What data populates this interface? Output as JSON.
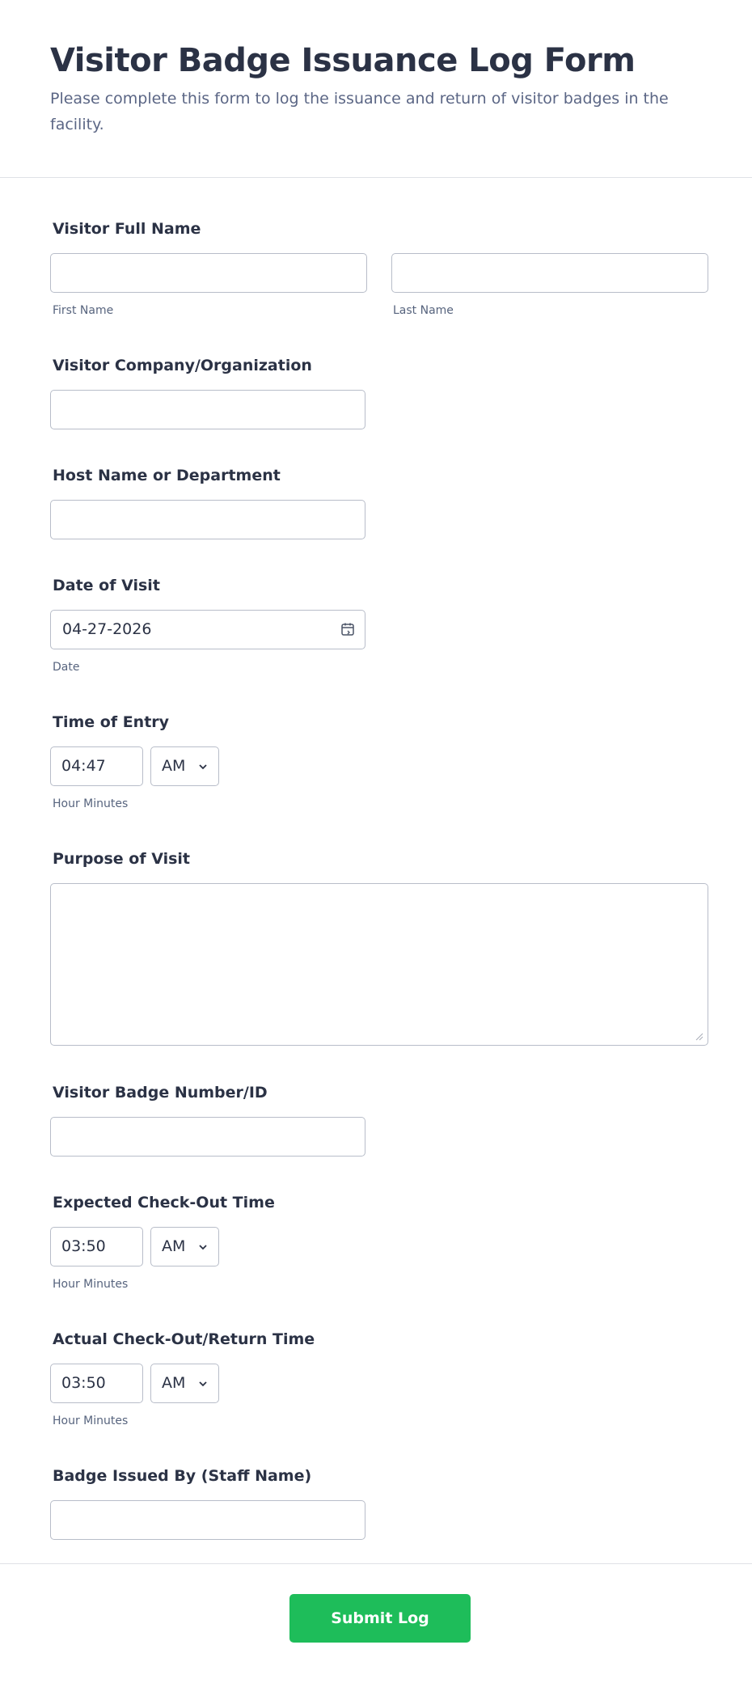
{
  "header": {
    "title": "Visitor Badge Issuance Log Form",
    "subtitle": "Please complete this form to log the issuance and return of visitor badges in the facility."
  },
  "fields": {
    "visitor_name": {
      "label": "Visitor Full Name",
      "first_sublabel": "First Name",
      "last_sublabel": "Last Name",
      "first_value": "",
      "last_value": ""
    },
    "company": {
      "label": "Visitor Company/Organization",
      "value": ""
    },
    "host": {
      "label": "Host Name or Department",
      "value": ""
    },
    "date": {
      "label": "Date of Visit",
      "value": "04-27-2026",
      "sublabel": "Date"
    },
    "entry_time": {
      "label": "Time of Entry",
      "time": "04:47",
      "ampm": "AM",
      "sublabel": "Hour Minutes"
    },
    "purpose": {
      "label": "Purpose of Visit",
      "value": ""
    },
    "badge_id": {
      "label": "Visitor Badge Number/ID",
      "value": ""
    },
    "expected_checkout": {
      "label": "Expected Check-Out Time",
      "time": "03:50",
      "ampm": "AM",
      "sublabel": "Hour Minutes"
    },
    "actual_checkout": {
      "label": "Actual Check-Out/Return Time",
      "time": "03:50",
      "ampm": "AM",
      "sublabel": "Hour Minutes"
    },
    "issued_by": {
      "label": "Badge Issued By (Staff Name)",
      "value": ""
    }
  },
  "submit": {
    "label": "Submit Log"
  },
  "colors": {
    "accent": "#1ebd5a",
    "text": "#2b3245",
    "subtext": "#5b6685",
    "border": "#b8bdc9"
  },
  "icons": {
    "date": "calendar-icon",
    "dropdown": "chevron-down-icon",
    "resize": "resize-handle-icon"
  }
}
